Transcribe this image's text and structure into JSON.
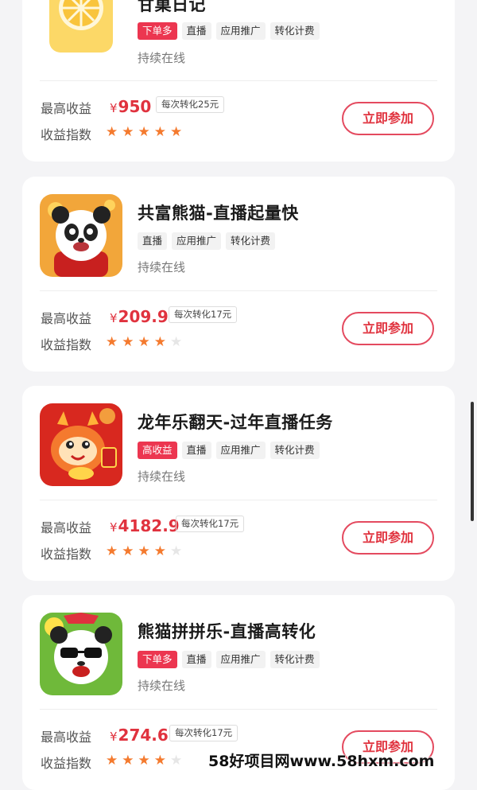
{
  "labels": {
    "max_income": "最高收益",
    "income_index": "收益指数",
    "join": "立即参加",
    "currency": "¥"
  },
  "tasks": [
    {
      "title": "甘菓日记",
      "tags": [
        "下单多",
        "直播",
        "应用推广",
        "转化计费"
      ],
      "hot_tag": true,
      "status": "持续在线",
      "price": "950",
      "per": "每次转化25元",
      "stars": 5,
      "icon": "orange-slice-icon"
    },
    {
      "title": "共富熊猫-直播起量快",
      "tags": [
        "直播",
        "应用推广",
        "转化计费"
      ],
      "hot_tag": false,
      "status": "持续在线",
      "price": "209.9",
      "per": "每次转化17元",
      "stars": 4,
      "icon": "panda-icon"
    },
    {
      "title": "龙年乐翻天-过年直播任务",
      "tags": [
        "高收益",
        "直播",
        "应用推广",
        "转化计费"
      ],
      "hot_tag": true,
      "status": "持续在线",
      "price": "4182.9",
      "per": "每次转化17元",
      "stars": 4,
      "icon": "dragon-icon"
    },
    {
      "title": "熊猫拼拼乐-直播高转化",
      "tags": [
        "下单多",
        "直播",
        "应用推广",
        "转化计费"
      ],
      "hot_tag": true,
      "status": "持续在线",
      "price": "274.6",
      "per": "每次转化17元",
      "stars": 4,
      "icon": "sunglasses-panda-icon"
    }
  ],
  "watermark": "58好项目网www.58hxm.com",
  "colors": {
    "accent": "#e0323e",
    "star": "#f47a2e",
    "hot_tag": "#ec3650"
  }
}
